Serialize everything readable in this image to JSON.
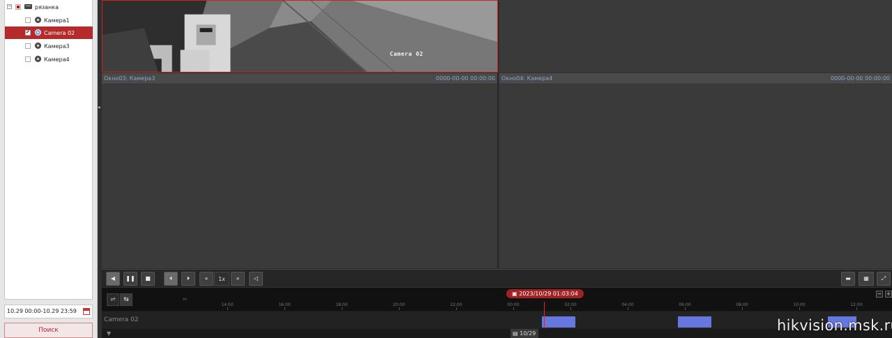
{
  "tree": {
    "root_label": "рязанка",
    "cameras": [
      {
        "label": "Камера1",
        "checked": false,
        "selected": false
      },
      {
        "label": "Camera 02",
        "checked": true,
        "selected": true
      },
      {
        "label": "Камера3",
        "checked": false,
        "selected": false
      },
      {
        "label": "Камера4",
        "checked": false,
        "selected": false
      }
    ]
  },
  "search": {
    "range": "10.29 00:00-10.29 23:59",
    "button_label": "Поиск"
  },
  "windows": {
    "w1_osd": "Camera 02",
    "w3_title": "Окно03:  Камера3",
    "w3_time": "0000-00-00 00:00:00",
    "w4_title": "Окно04:  Камера4",
    "w4_time": "0000-00-00 00:00:00"
  },
  "controls": {
    "speed": "1x"
  },
  "timeline": {
    "current_time": "2023/10/29 01:03:04",
    "ticks": [
      "14:00",
      "16:00",
      "18:00",
      "20:00",
      "22:00",
      "00:00",
      "02:00",
      "04:00",
      "06:00",
      "08:00",
      "10:00",
      "12:00"
    ],
    "track_label": "Camera 02",
    "date_tab": "10/29",
    "recordings": [
      {
        "start": "01:00",
        "end": "02:10"
      },
      {
        "start": "05:45",
        "end": "06:55"
      },
      {
        "start": "11:00",
        "end": "12:00"
      }
    ]
  },
  "watermark": "hikvision.msk.ru",
  "colors": {
    "accent": "#b52a2a",
    "recording": "#6677dd",
    "cursor": "#e22222"
  }
}
